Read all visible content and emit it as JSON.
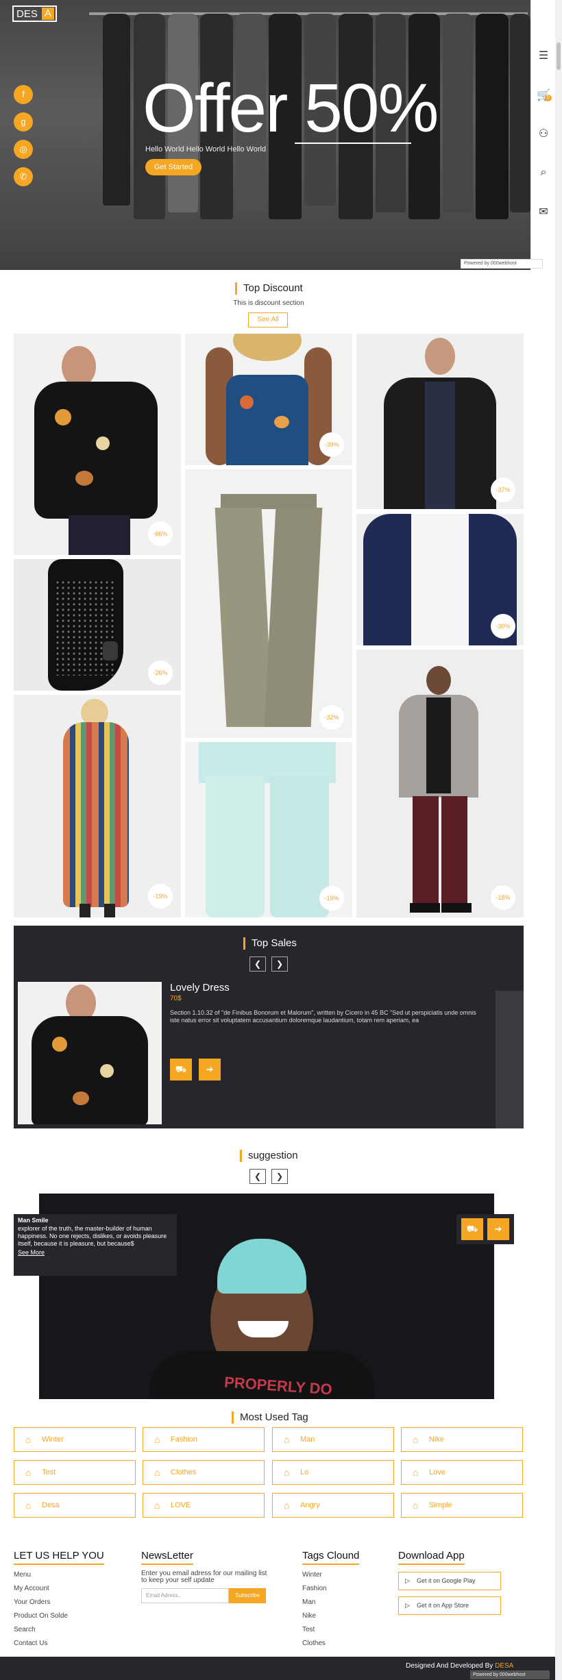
{
  "brand": {
    "logo_left": "DES",
    "logo_right": "A"
  },
  "hero": {
    "headline": "Offer 50%",
    "subtitle": "Hello World Hello World Hello World",
    "cta": "Get Started"
  },
  "header": {
    "cart_count": "0"
  },
  "powered": "Powered by  000webhost",
  "discount": {
    "title": "Top Discount",
    "subtitle": "This is discount section",
    "see_all": "See All",
    "products": [
      {
        "badge": "-66%"
      },
      {
        "badge": "-39%"
      },
      {
        "badge": "-37%"
      },
      {
        "badge": "-26%"
      },
      {
        "badge": "-32%"
      },
      {
        "badge": "-30%"
      },
      {
        "badge": "-19%"
      },
      {
        "badge": "-19%"
      },
      {
        "badge": "-18%"
      }
    ]
  },
  "sales": {
    "title": "Top Sales",
    "product_name": "Lovely Dress",
    "price": "70$",
    "description": "Section 1.10.32 of \"de Finibus Bonorum et Malorum\", written by Cicero in 45 BC \"Sed ut perspiciatis unde omnis iste natus error sit voluptatem accusantium doloremque laudantium, totam rem aperiam, ea"
  },
  "suggestion": {
    "title": "suggestion",
    "name": "Man Smile",
    "text": "explorer of the truth, the master-builder of human happiness. No one rejects, dislikes, or avoids pleasure itself, because it is pleasure, but because$",
    "see_more": "See More",
    "shirt_text": "PROPERLY DO"
  },
  "tags": {
    "title": "Most Used Tag",
    "items": [
      "Winter",
      "Fashion",
      "Man",
      "Nike",
      "Test",
      "Clothes",
      "Lo",
      "Love",
      "Desa",
      "LOVE",
      "Angry",
      "Simple"
    ]
  },
  "footer": {
    "help": {
      "title": "LET US HELP YOU",
      "links": [
        "Menu",
        "My Account",
        "Your Orders",
        "Product On Solde",
        "Search",
        "Contact Us"
      ]
    },
    "newsletter": {
      "title": "NewsLetter",
      "text": "Enter you email adress for our mailing list to keep your self update",
      "placeholder": "Email Adress..",
      "button": "Subscribe"
    },
    "tags": {
      "title": "Tags Clound",
      "links": [
        "Winter",
        "Fashion",
        "Man",
        "Nike",
        "Test",
        "Clothes"
      ]
    },
    "app": {
      "title": "Download App",
      "google": "Get it on Google Play",
      "apple": "Get it on App Store"
    },
    "credit_prefix": "Designed And Developed By ",
    "credit_brand": "DESA"
  },
  "colors": {
    "accent": "#f5a623",
    "dark": "#26262c"
  }
}
